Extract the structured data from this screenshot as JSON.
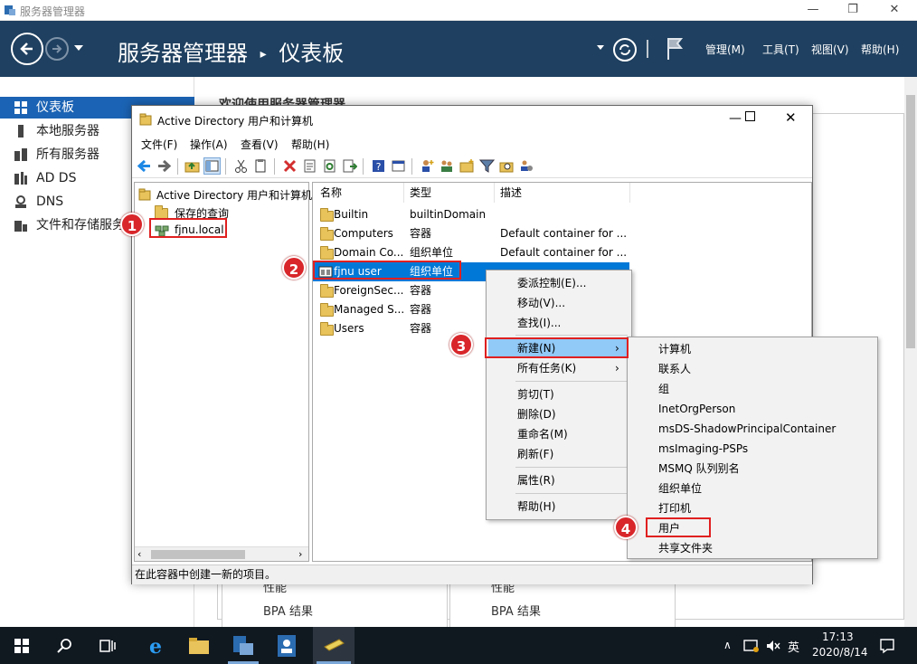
{
  "sm": {
    "window_title": "服务器管理器",
    "breadcrumb_app": "服务器管理器",
    "breadcrumb_sep": "▸",
    "breadcrumb_page": "仪表板",
    "menus": [
      "管理(M)",
      "工具(T)",
      "视图(V)",
      "帮助(H)"
    ],
    "sidebar": [
      {
        "label": "仪表板",
        "icon": "dashboard-icon",
        "selected": true
      },
      {
        "label": "本地服务器",
        "icon": "server-icon"
      },
      {
        "label": "所有服务器",
        "icon": "servers-icon"
      },
      {
        "label": "AD DS",
        "icon": "ad-ds-icon"
      },
      {
        "label": "DNS",
        "icon": "dns-icon"
      },
      {
        "label": "文件和存储服务",
        "icon": "storage-icon"
      }
    ],
    "welcome": "欢迎使用服务器管理器",
    "perf_label": "性能",
    "bpa_label": "BPA 结果"
  },
  "aduc": {
    "title": "Active Directory 用户和计算机",
    "menus": [
      "文件(F)",
      "操作(A)",
      "查看(V)",
      "帮助(H)"
    ],
    "tree": {
      "root": "Active Directory 用户和计算机",
      "saved": "保存的查询",
      "domain": "fjnu.local"
    },
    "columns": [
      "名称",
      "类型",
      "描述"
    ],
    "rows": [
      {
        "name": "Builtin",
        "type": "builtinDomain",
        "desc": ""
      },
      {
        "name": "Computers",
        "type": "容器",
        "desc": "Default container for ..."
      },
      {
        "name": "Domain Co...",
        "type": "组织单位",
        "desc": "Default container for ..."
      },
      {
        "name": "fjnu user",
        "type": "组织单位",
        "desc": ""
      },
      {
        "name": "ForeignSec...",
        "type": "容器",
        "desc": ""
      },
      {
        "name": "Managed S...",
        "type": "容器",
        "desc": ""
      },
      {
        "name": "Users",
        "type": "容器",
        "desc": ""
      }
    ],
    "status": "在此容器中创建一新的项目。"
  },
  "context_menu": {
    "items": [
      "委派控制(E)...",
      "移动(V)...",
      "查找(I)...",
      "新建(N)",
      "所有任务(K)",
      "剪切(T)",
      "删除(D)",
      "重命名(M)",
      "刷新(F)",
      "属性(R)",
      "帮助(H)"
    ]
  },
  "submenu": {
    "items": [
      "计算机",
      "联系人",
      "组",
      "InetOrgPerson",
      "msDS-ShadowPrincipalContainer",
      "msImaging-PSPs",
      "MSMQ 队列别名",
      "组织单位",
      "打印机",
      "用户",
      "共享文件夹"
    ]
  },
  "badges": [
    "1",
    "2",
    "3",
    "4"
  ],
  "taskbar": {
    "time": "17:13",
    "date": "2020/8/14",
    "ime": "英"
  },
  "colors": {
    "header": "#1f4060",
    "selection": "#1b63b4",
    "highlight": "#0078d7",
    "annotation": "#d8262a"
  }
}
